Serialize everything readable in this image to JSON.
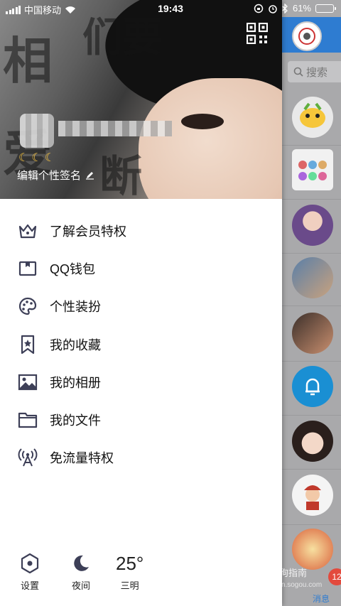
{
  "status_bar": {
    "carrier": "中国移动",
    "time": "19:43",
    "battery": "61%",
    "battery_level": 0.61
  },
  "profile": {
    "signature": "编辑个性签名",
    "level_icons": "☾☾☾"
  },
  "menu": {
    "items": [
      {
        "label": "了解会员特权",
        "icon": "crown-icon"
      },
      {
        "label": "QQ钱包",
        "icon": "wallet-icon"
      },
      {
        "label": "个性装扮",
        "icon": "palette-icon"
      },
      {
        "label": "我的收藏",
        "icon": "bookmark-icon"
      },
      {
        "label": "我的相册",
        "icon": "photo-icon"
      },
      {
        "label": "我的文件",
        "icon": "folder-icon"
      },
      {
        "label": "免流量特权",
        "icon": "antenna-icon"
      }
    ]
  },
  "bottom_bar": {
    "settings_label": "设置",
    "night_label": "夜间",
    "temperature": "25°",
    "city": "三明"
  },
  "right_panel": {
    "search_placeholder": "搜索",
    "badge_count": "12",
    "messages_tab": "消息"
  },
  "watermark": {
    "text": "搜狗指南",
    "url": "zhinan.sogou.com"
  },
  "colors": {
    "accent": "#2e7cd1",
    "badge": "#e34a3d",
    "icon": "#3d3f57"
  }
}
